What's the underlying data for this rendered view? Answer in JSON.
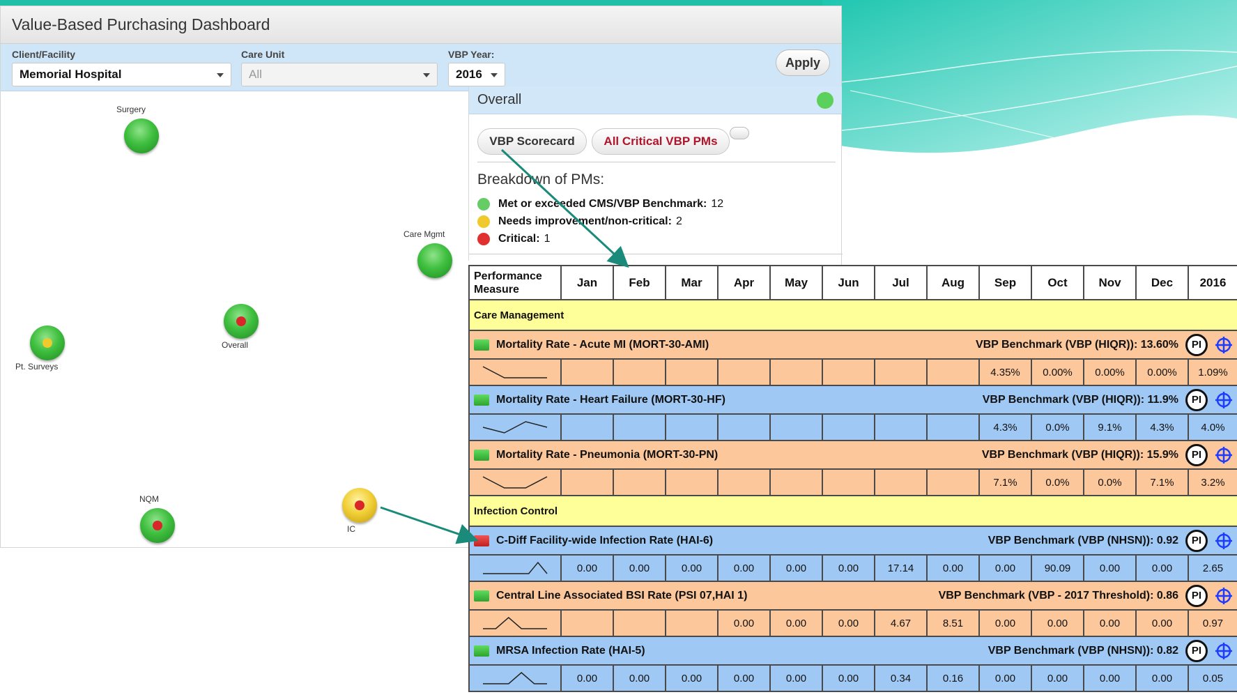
{
  "app": {
    "title": "Value-Based Purchasing Dashboard"
  },
  "filters": {
    "client_label": "Client/Facility",
    "client_value": "Memorial Hospital",
    "unit_label": "Care Unit",
    "unit_value": "All",
    "year_label": "VBP Year:",
    "year_value": "2016",
    "apply_label": "Apply"
  },
  "map": {
    "nodes": [
      {
        "label": "Surgery",
        "color": "green",
        "dot": "none"
      },
      {
        "label": "Care Mgmt",
        "color": "green",
        "dot": "none"
      },
      {
        "label": "Overall",
        "color": "green",
        "dot": "red"
      },
      {
        "label": "Pt. Surveys",
        "color": "green",
        "dot": "yellow"
      },
      {
        "label": "NQM",
        "color": "green",
        "dot": "red"
      },
      {
        "label": "IC",
        "color": "yellow",
        "dot": "red"
      }
    ]
  },
  "overall": {
    "title": "Overall",
    "status_color": "#5cd05c",
    "tab_scorecard": "VBP Scorecard",
    "tab_critical": "All Critical VBP PMs",
    "breakdown_title": "Breakdown of PMs:",
    "breakdown": [
      {
        "label": "Met or exceeded CMS/VBP Benchmark:",
        "count": "12",
        "color": "#66cc66"
      },
      {
        "label": "Needs improvement/non-critical:",
        "count": "2",
        "color": "#f0c92c"
      },
      {
        "label": "Critical:",
        "count": "1",
        "color": "#e03030"
      }
    ]
  },
  "table": {
    "header_first": "Performance Measure",
    "months": [
      "Jan",
      "Feb",
      "Mar",
      "Apr",
      "May",
      "Jun",
      "Jul",
      "Aug",
      "Sep",
      "Oct",
      "Nov",
      "Dec"
    ],
    "year": "2016",
    "sections": [
      {
        "title": "Care Management",
        "measures": [
          {
            "name": "Mortality Rate - Acute MI (MORT-30-AMI)",
            "benchmark": "VBP Benchmark (VBP (HIQR)): 13.60%",
            "status": "green",
            "color": "orange",
            "spark": [
              3,
              1,
              1,
              1
            ],
            "values": [
              "",
              "",
              "",
              "",
              "",
              "",
              "",
              "",
              "4.35%",
              "0.00%",
              "0.00%",
              "0.00%"
            ],
            "year_value": "1.09%",
            "year_dark": false
          },
          {
            "name": "Mortality Rate - Heart Failure (MORT-30-HF)",
            "benchmark": "VBP Benchmark (VBP (HIQR)): 11.9%",
            "status": "green",
            "color": "blue",
            "spark": [
              2,
              1,
              3,
              2
            ],
            "values": [
              "",
              "",
              "",
              "",
              "",
              "",
              "",
              "",
              "4.3%",
              "0.0%",
              "9.1%",
              "4.3%"
            ],
            "year_value": "4.0%",
            "year_dark": false
          },
          {
            "name": "Mortality Rate - Pneumonia (MORT-30-PN)",
            "benchmark": "VBP Benchmark (VBP (HIQR)): 15.9%",
            "status": "green",
            "color": "orange",
            "spark": [
              3,
              1,
              1,
              3
            ],
            "values": [
              "",
              "",
              "",
              "",
              "",
              "",
              "",
              "",
              "7.1%",
              "0.0%",
              "0.0%",
              "7.1%"
            ],
            "year_value": "3.2%",
            "year_dark": false
          }
        ]
      },
      {
        "title": "Infection Control",
        "measures": [
          {
            "name": "C-Diff Facility-wide Infection Rate (HAI-6)",
            "benchmark": "VBP Benchmark (VBP (NHSN)): 0.92",
            "status": "red",
            "color": "blue",
            "spark": [
              1,
              1,
              1,
              1,
              1,
              1,
              3,
              1
            ],
            "values": [
              "0.00",
              "0.00",
              "0.00",
              "0.00",
              "0.00",
              "0.00",
              "17.14",
              "0.00",
              "0.00",
              "90.09",
              "0.00",
              "0.00"
            ],
            "year_value": "2.65",
            "year_dark": true
          },
          {
            "name": "Central Line Associated BSI Rate (PSI 07,HAI 1)",
            "benchmark": "VBP Benchmark (VBP - 2017 Threshold): 0.86",
            "status": "green",
            "color": "orange",
            "spark": [
              1,
              1,
              3,
              1,
              1,
              1
            ],
            "values": [
              "",
              "",
              "",
              "0.00",
              "0.00",
              "0.00",
              "4.67",
              "8.51",
              "0.00",
              "0.00",
              "0.00",
              "0.00"
            ],
            "year_value": "0.97",
            "year_dark": false
          },
          {
            "name": "MRSA Infection Rate (HAI-5)",
            "benchmark": "VBP Benchmark (VBP (NHSN)): 0.82",
            "status": "green",
            "color": "blue",
            "spark": [
              1,
              1,
              1,
              3,
              1,
              1
            ],
            "values": [
              "0.00",
              "0.00",
              "0.00",
              "0.00",
              "0.00",
              "0.00",
              "0.34",
              "0.16",
              "0.00",
              "0.00",
              "0.00",
              "0.00"
            ],
            "year_value": "0.05",
            "year_dark": true
          }
        ]
      }
    ]
  }
}
